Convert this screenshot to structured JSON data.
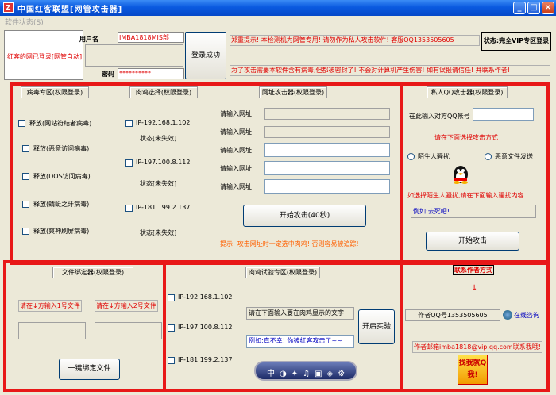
{
  "window": {
    "icon_text": "Z",
    "title": "中国红客联盟[网管攻击器]"
  },
  "menu": {
    "status": "软件状态(S)"
  },
  "login": {
    "user_label": "用户名",
    "user_value": "IMBA1818MIS部",
    "pass_label": "密码",
    "pass_value": "**********",
    "sidebar_text": "红客的网已登录[网管自动]",
    "login_button": "登录成功"
  },
  "notice": {
    "line1": "郑重提示! 本检测机为网管专用! 请勿作为私人攻击软件! 客服QQ1353505605",
    "line2": "为了攻击需要本软件含有病毒,但都被密封了! 不会对计算机产生伤害! 如有误报请信任! 并联系作者!",
    "status": "状态:完全VIP专区登录"
  },
  "virus": {
    "header": "病毒专区(权限登录)",
    "items": [
      "释放(网站符结者病毒)",
      "释放(恶意访问病毒)",
      "释放(DOS访问病毒)",
      "释放(蜻蜓之牙病毒)",
      "释放(爽神刷屏病毒)"
    ]
  },
  "chicken": {
    "header": "肉鸡选择(权限登录)",
    "items": [
      {
        "ip": "IP-192.168.1.102",
        "status": "状态[未失效]"
      },
      {
        "ip": "IP-197.100.8.112",
        "status": "状态[未失效]"
      },
      {
        "ip": "IP-181.199.2.137",
        "status": "状态[未失效]"
      }
    ]
  },
  "url_attack": {
    "header": "网址攻击器(权限登录)",
    "prompt": "请输入网址",
    "button": "开始攻击(40秒)",
    "warning": "提示! 攻击网址时一定选中肉鸡! 否则容易被追踪!"
  },
  "qq_attack": {
    "header": "私人QQ攻击器(权限登录)",
    "input_label": "在此输入对方QQ帐号",
    "choose_text": "请在下面选择攻击方式",
    "opt1": "陌生人骚扰",
    "opt2": "恶意文件发送",
    "hint": "如选择陌生人骚扰,请在下面输入骚扰内容",
    "example": "例如:去死吧!",
    "button": "开始攻击"
  },
  "file_binder": {
    "header": "文件绑定器(权限登录)",
    "label1": "请在↓方输入1号文件",
    "label2": "请在↓方输入2号文件",
    "button": "一键绑定文件"
  },
  "chicken_test": {
    "header": "肉鸡试验专区(权限登录)",
    "items": [
      "IP-192.168.1.102",
      "IP-197.100.8.112",
      "IP-181.199.2.137"
    ],
    "prompt": "请在下面输入要在肉鸡显示的文字",
    "example": "例如;真不幸! 你被红客攻击了~~",
    "button": "开启实验"
  },
  "contact": {
    "header": "联系作者方式",
    "arrow": "↓",
    "qq": "作者QQ号1353505605",
    "online": "在线咨询",
    "email": "作者邮箱imba1818@vip.qq.com联系我哦!",
    "badge": "找我就Q我!"
  },
  "colors": {
    "panel_border": "#e81818",
    "title_blue": "#0a5ae0"
  }
}
